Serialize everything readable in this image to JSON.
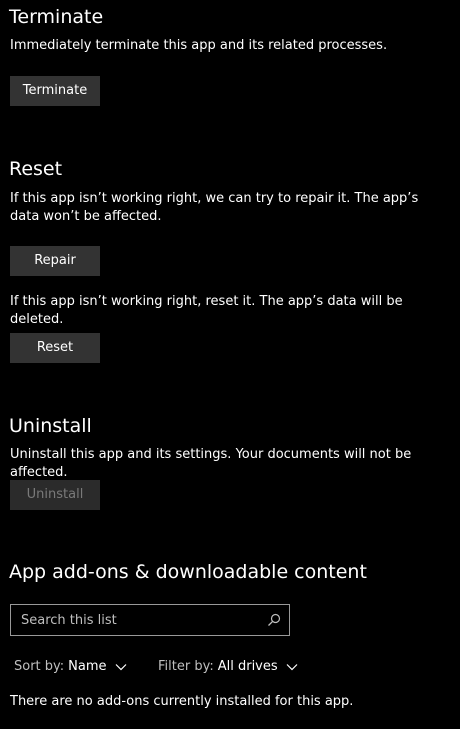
{
  "terminate": {
    "title": "Terminate",
    "description": "Immediately terminate this app and its related processes.",
    "button": "Terminate"
  },
  "reset": {
    "title": "Reset",
    "repair_description": "If this app isn’t working right, we can try to repair it. The app’s data won’t be affected.",
    "repair_button": "Repair",
    "reset_description": "If this app isn’t working right, reset it. The app’s data will be deleted.",
    "reset_button": "Reset"
  },
  "uninstall": {
    "title": "Uninstall",
    "description": "Uninstall this app and its settings. Your documents will not be affected.",
    "button": "Uninstall"
  },
  "addons": {
    "title": "App add-ons & downloadable content",
    "search_placeholder": "Search this list",
    "search_value": "",
    "search_icon": "search-icon",
    "sort_label": "Sort by:",
    "sort_value": "Name",
    "filter_label": "Filter by:",
    "filter_value": "All drives",
    "empty_message": "There are no add-ons currently installed for this app."
  },
  "colors": {
    "background": "#000000",
    "button": "#333333",
    "button_disabled": "#2b2b2b",
    "text": "#ffffff",
    "text_disabled": "#7a7a7a"
  }
}
